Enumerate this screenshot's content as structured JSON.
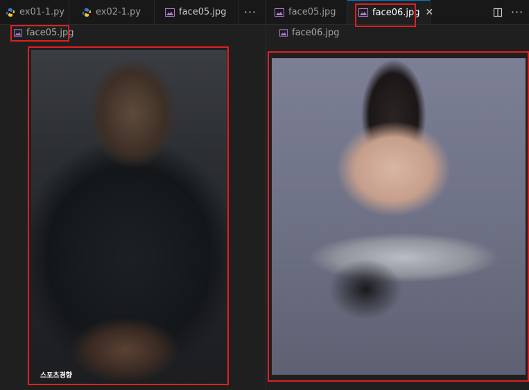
{
  "left_pane": {
    "tabs": [
      {
        "label": "ex01-1.py",
        "icon": "python-icon"
      },
      {
        "label": "ex02-1.py",
        "icon": "python-icon"
      },
      {
        "label": "face05.jpg",
        "icon": "image-file-icon"
      }
    ],
    "more_label": "···",
    "breadcrumb": "face05.jpg",
    "image": {
      "watermark": "스포츠경향"
    }
  },
  "right_pane": {
    "tabs": [
      {
        "label": "face05.jpg",
        "icon": "image-file-icon"
      },
      {
        "label": "face06.jpg",
        "icon": "image-file-icon",
        "close": "✕"
      }
    ],
    "more_label": "···",
    "breadcrumb": "face06.jpg"
  },
  "colors": {
    "highlight": "#e02020",
    "image_icon": "#b180d7",
    "python_icon": "#3b7bbf"
  }
}
